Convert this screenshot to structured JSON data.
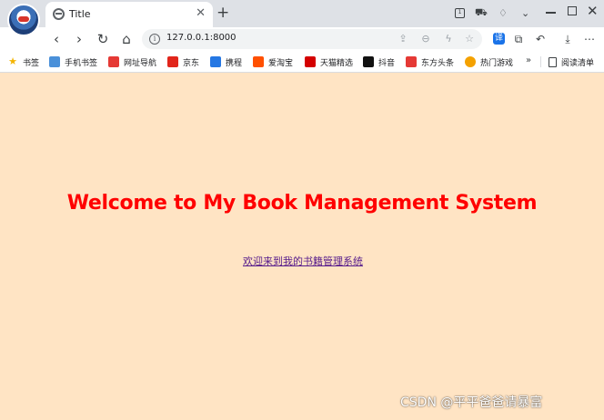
{
  "colors": {
    "page_bg": "#ffe4c4",
    "heading": "#ff0000",
    "link": "#551a8b",
    "accent": "#1a73e8"
  },
  "tab": {
    "title": "Title",
    "icon": "globe-icon"
  },
  "address_bar": {
    "url": "127.0.0.1:8000"
  },
  "bookmarks": [
    {
      "label": "书签",
      "icon": "star-icon"
    },
    {
      "label": "手机书签",
      "icon": "phone-icon"
    },
    {
      "label": "网址导航",
      "icon": "nav-icon"
    },
    {
      "label": "京东",
      "icon": "jd-icon"
    },
    {
      "label": "携程",
      "icon": "ctrip-icon"
    },
    {
      "label": "爱淘宝",
      "icon": "taobao-icon"
    },
    {
      "label": "天猫精选",
      "icon": "tmall-icon"
    },
    {
      "label": "抖音",
      "icon": "douyin-icon"
    },
    {
      "label": "东方头条",
      "icon": "eastday-icon"
    },
    {
      "label": "热门游戏",
      "icon": "game-icon"
    }
  ],
  "reading_list": {
    "label": "阅读清单"
  },
  "page": {
    "heading": "Welcome to My Book Management System",
    "link_text": "欢迎来到我的书籍管理系统"
  },
  "watermark": "CSDN @平平爸爸请暴富"
}
